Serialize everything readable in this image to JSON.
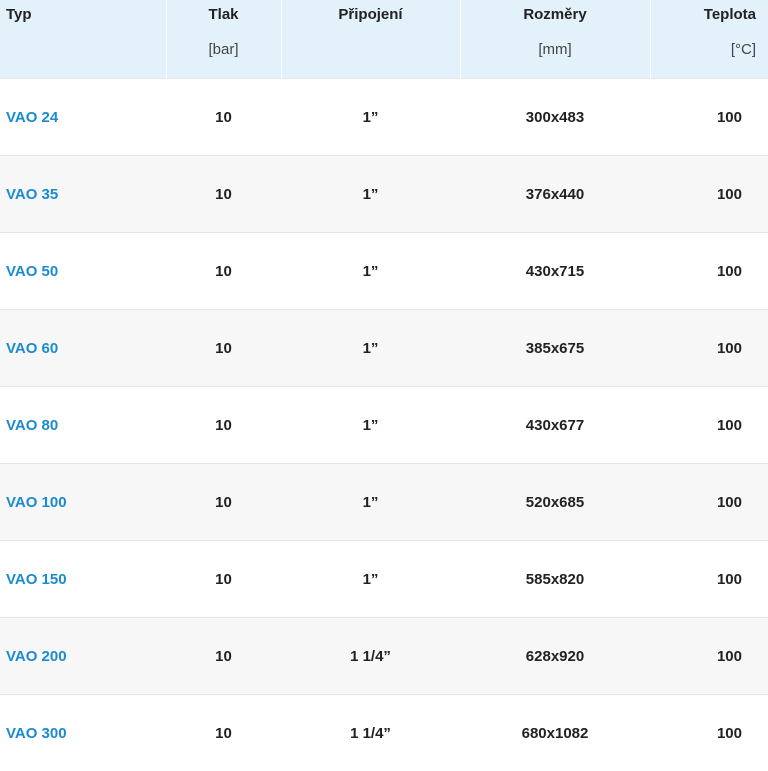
{
  "table": {
    "headers": [
      {
        "label": "Typ",
        "unit": ""
      },
      {
        "label": "Tlak",
        "unit": "[bar]"
      },
      {
        "label": "Připojení",
        "unit": ""
      },
      {
        "label": "Rozměry",
        "unit": "[mm]"
      },
      {
        "label": "Teplota",
        "unit": "[°C]"
      }
    ],
    "rows": [
      {
        "typ": "VAO 24",
        "tlak": "10",
        "pripojeni": "1”",
        "rozmery": "300x483",
        "teplota": "100"
      },
      {
        "typ": "VAO 35",
        "tlak": "10",
        "pripojeni": "1”",
        "rozmery": "376x440",
        "teplota": "100"
      },
      {
        "typ": "VAO 50",
        "tlak": "10",
        "pripojeni": "1”",
        "rozmery": "430x715",
        "teplota": "100"
      },
      {
        "typ": "VAO 60",
        "tlak": "10",
        "pripojeni": "1”",
        "rozmery": "385x675",
        "teplota": "100"
      },
      {
        "typ": "VAO 80",
        "tlak": "10",
        "pripojeni": "1”",
        "rozmery": "430x677",
        "teplota": "100"
      },
      {
        "typ": "VAO 100",
        "tlak": "10",
        "pripojeni": "1”",
        "rozmery": "520x685",
        "teplota": "100"
      },
      {
        "typ": "VAO 150",
        "tlak": "10",
        "pripojeni": "1”",
        "rozmery": "585x820",
        "teplota": "100"
      },
      {
        "typ": "VAO 200",
        "tlak": "10",
        "pripojeni": "1 1/4”",
        "rozmery": "628x920",
        "teplota": "100"
      },
      {
        "typ": "VAO 300",
        "tlak": "10",
        "pripojeni": "1 1/4”",
        "rozmery": "680x1082",
        "teplota": "100"
      }
    ]
  },
  "colors": {
    "header_background": "#e3f1fb",
    "type_link": "#1a8bd0",
    "row_alt_background": "#f7f7f7"
  }
}
